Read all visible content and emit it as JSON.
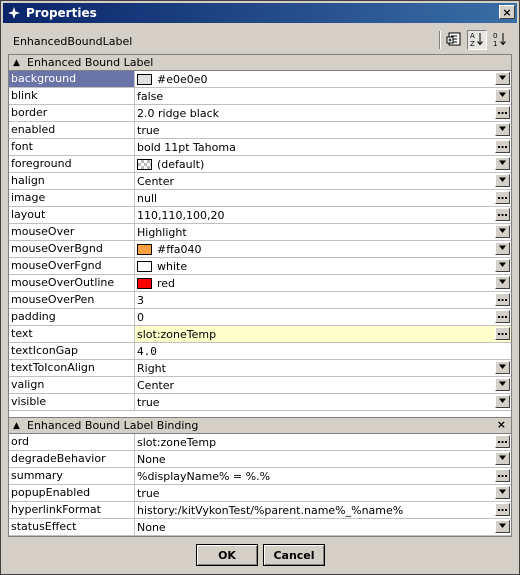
{
  "window": {
    "title": "Properties"
  },
  "header": {
    "label": "EnhancedBoundLabel"
  },
  "section1": {
    "title": "Enhanced Bound Label",
    "rows": [
      {
        "name": "background",
        "value": "#e0e0e0",
        "swatch": "#e0e0e0",
        "btn": "dropdown"
      },
      {
        "name": "blink",
        "value": "false",
        "btn": "dropdown"
      },
      {
        "name": "border",
        "value": "2.0 ridge black",
        "btn": "ellipsis"
      },
      {
        "name": "enabled",
        "value": "true",
        "btn": "dropdown"
      },
      {
        "name": "font",
        "value": "bold 11pt Tahoma",
        "btn": "ellipsis"
      },
      {
        "name": "foreground",
        "value": "(default)",
        "swatch": "checker",
        "btn": "dropdown"
      },
      {
        "name": "halign",
        "value": "Center",
        "btn": "dropdown"
      },
      {
        "name": "image",
        "value": "null",
        "btn": "ellipsis"
      },
      {
        "name": "layout",
        "value": "110,110,100,20",
        "btn": "ellipsis"
      },
      {
        "name": "mouseOver",
        "value": "Highlight",
        "btn": "dropdown"
      },
      {
        "name": "mouseOverBgnd",
        "value": "#ffa040",
        "swatch": "#ffa040",
        "btn": "dropdown"
      },
      {
        "name": "mouseOverFgnd",
        "value": "white",
        "swatch": "#ffffff",
        "btn": "dropdown"
      },
      {
        "name": "mouseOverOutline",
        "value": "red",
        "swatch": "#ff0000",
        "btn": "dropdown"
      },
      {
        "name": "mouseOverPen",
        "value": "3",
        "btn": "ellipsis"
      },
      {
        "name": "padding",
        "value": "0",
        "btn": "ellipsis"
      },
      {
        "name": "text",
        "value": "slot:zoneTemp",
        "btn": "ellipsis",
        "highlight": true
      },
      {
        "name": "textIconGap",
        "value": "4.0",
        "btn": "none",
        "mono": true
      },
      {
        "name": "textToIconAlign",
        "value": "Right",
        "btn": "dropdown"
      },
      {
        "name": "valign",
        "value": "Center",
        "btn": "dropdown"
      },
      {
        "name": "visible",
        "value": "true",
        "btn": "dropdown"
      }
    ]
  },
  "section2": {
    "title": "Enhanced Bound Label Binding",
    "close_icon": "×",
    "rows": [
      {
        "name": "ord",
        "value": "slot:zoneTemp",
        "btn": "ellipsis"
      },
      {
        "name": "degradeBehavior",
        "value": "None",
        "btn": "dropdown"
      },
      {
        "name": "summary",
        "value": "%displayName% = %.%",
        "btn": "ellipsis"
      },
      {
        "name": "popupEnabled",
        "value": "true",
        "btn": "dropdown"
      },
      {
        "name": "hyperlinkFormat",
        "value": "history:/kitVykonTest/%parent.name%_%name%",
        "btn": "ellipsis"
      },
      {
        "name": "statusEffect",
        "value": "None",
        "btn": "dropdown"
      }
    ]
  },
  "buttons": {
    "ok": "OK",
    "cancel": "Cancel"
  },
  "colors": {
    "title_start": "#0a246a",
    "title_end": "#3a6ea5",
    "selected": "#6b74a8",
    "highlight": "#ffffcc",
    "face": "#d4d0c8"
  }
}
